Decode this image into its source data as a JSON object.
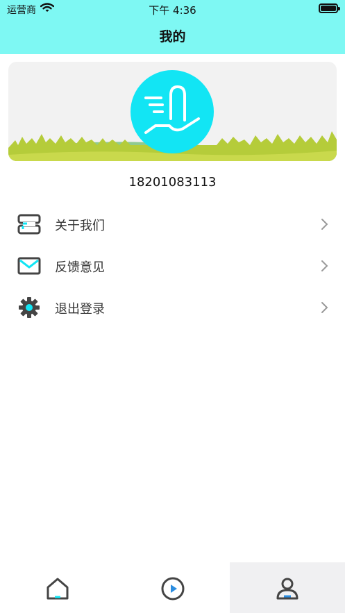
{
  "status_bar": {
    "carrier": "运营商",
    "time": "下午 4:36"
  },
  "header": {
    "title": "我的"
  },
  "profile": {
    "phone": "18201083113"
  },
  "menu": [
    {
      "label": "关于我们",
      "icon": "server-icon"
    },
    {
      "label": "反馈意见",
      "icon": "mail-icon"
    },
    {
      "label": "退出登录",
      "icon": "gear-icon"
    }
  ],
  "tabbar": {
    "items": [
      {
        "icon": "home-icon",
        "active": false
      },
      {
        "icon": "play-icon",
        "active": false
      },
      {
        "icon": "profile-icon",
        "active": true
      }
    ]
  },
  "colors": {
    "header_bg": "#7ef8f3",
    "avatar_bg": "#12e5f4",
    "accent": "#12e5f4"
  }
}
